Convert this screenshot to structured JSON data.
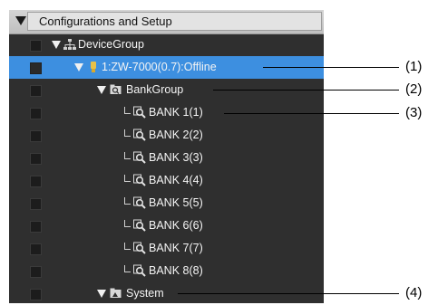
{
  "tree": {
    "header": {
      "label": "Configurations and Setup"
    },
    "device_group": {
      "label": "DeviceGroup"
    },
    "device": {
      "label": "1:ZW-7000(0.7):Offline"
    },
    "bank_group": {
      "label": "BankGroup"
    },
    "banks": [
      {
        "label": "BANK 1(1)"
      },
      {
        "label": "BANK 2(2)"
      },
      {
        "label": "BANK 3(3)"
      },
      {
        "label": "BANK 4(4)"
      },
      {
        "label": "BANK 5(5)"
      },
      {
        "label": "BANK 6(6)"
      },
      {
        "label": "BANK 7(7)"
      },
      {
        "label": "BANK 8(8)"
      }
    ],
    "system": {
      "label": "System"
    }
  },
  "callouts": [
    "(1)",
    "(2)",
    "(3)",
    "(4)"
  ],
  "icons": {
    "device_group": "network-icon",
    "device": "sensor-device-icon",
    "bank_group": "folder-search-icon",
    "bank": "magnifier-icon",
    "system": "folder-icon"
  },
  "colors": {
    "panel_bg": "#2f2f2f",
    "selection": "#3d8fe0",
    "text": "#f4f4f4"
  }
}
